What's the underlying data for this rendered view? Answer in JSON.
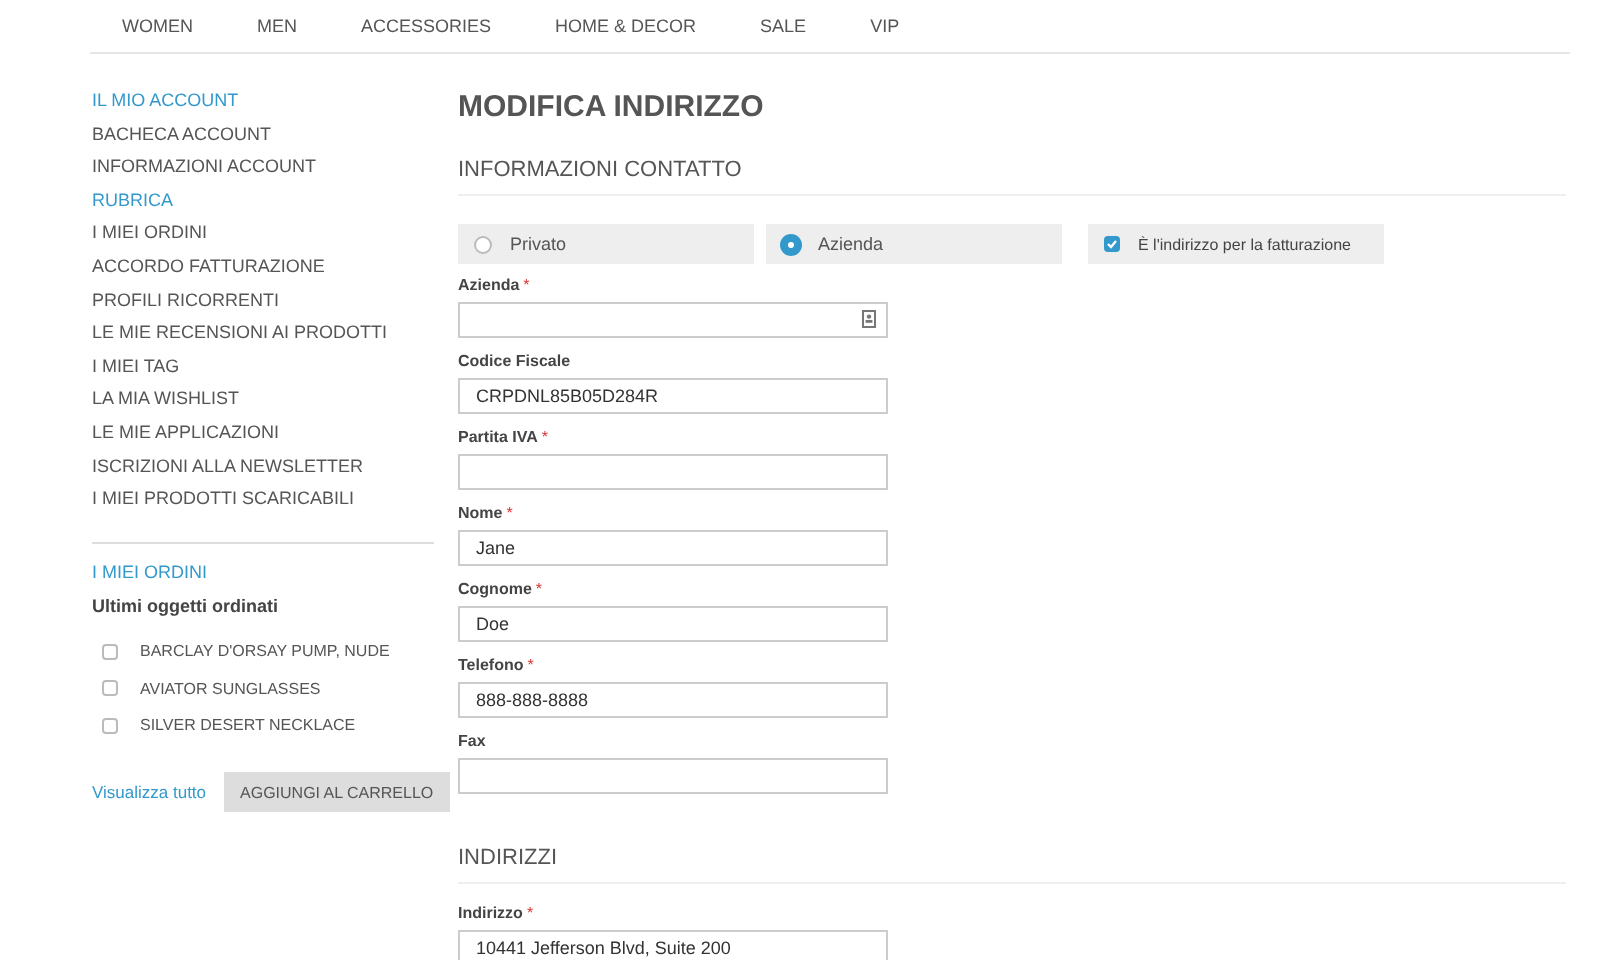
{
  "nav": [
    "WOMEN",
    "MEN",
    "ACCESSORIES",
    "HOME & DECOR",
    "SALE",
    "VIP"
  ],
  "sidebar": {
    "title": "IL MIO ACCOUNT",
    "items": [
      {
        "label": "BACHECA ACCOUNT",
        "selected": false
      },
      {
        "label": "INFORMAZIONI ACCOUNT",
        "selected": false
      },
      {
        "label": "RUBRICA",
        "selected": true
      },
      {
        "label": "I MIEI ORDINI",
        "selected": false
      },
      {
        "label": "ACCORDO FATTURAZIONE",
        "selected": false
      },
      {
        "label": "PROFILI RICORRENTI",
        "selected": false
      },
      {
        "label": "LE MIE RECENSIONI AI PRODOTTI",
        "selected": false
      },
      {
        "label": "I MIEI TAG",
        "selected": false
      },
      {
        "label": "LA MIA WISHLIST",
        "selected": false
      },
      {
        "label": "LE MIE APPLICAZIONI",
        "selected": false
      },
      {
        "label": "ISCRIZIONI ALLA NEWSLETTER",
        "selected": false
      },
      {
        "label": "I MIEI PRODOTTI SCARICABILI",
        "selected": false
      }
    ]
  },
  "orders": {
    "title": "I MIEI ORDINI",
    "subtitle": "Ultimi oggetti ordinati",
    "items": [
      {
        "label": "BARCLAY D'ORSAY PUMP, NUDE",
        "checked": false
      },
      {
        "label": "AVIATOR SUNGLASSES",
        "checked": false
      },
      {
        "label": "SILVER DESERT NECKLACE",
        "checked": false
      }
    ],
    "link": "Visualizza tutto",
    "button": "AGGIUNGI AL CARRELLO"
  },
  "page_title": "MODIFICA INDIRIZZO",
  "contact": {
    "heading": "INFORMAZIONI CONTATTO",
    "types": [
      {
        "label": "Privato",
        "selected": false
      },
      {
        "label": "Azienda",
        "selected": true
      }
    ],
    "billing": {
      "label": "È l'indirizzo per la fatturazione",
      "checked": true
    },
    "fields": [
      {
        "label": "Azienda",
        "required_mark": "*",
        "kind": "contact"
      },
      {
        "label": "Codice Fiscale",
        "value": "CRPDNL85B05D284R",
        "kind": "text"
      },
      {
        "label": "Partita IVA",
        "required_mark": "*",
        "kind": "text"
      },
      {
        "label": "Nome",
        "required_mark": "*",
        "value": "Jane",
        "kind": "text"
      },
      {
        "label": "Cognome",
        "required_mark": "*",
        "value": "Doe",
        "kind": "text"
      },
      {
        "label": "Telefono",
        "required_mark": "*",
        "value": "888-888-8888",
        "kind": "text"
      },
      {
        "label": "Fax",
        "kind": "text"
      }
    ]
  },
  "addresses": {
    "heading": "INDIRIZZI",
    "fields": [
      {
        "label": "Indirizzo",
        "required_mark": "*",
        "value": "10441 Jefferson Blvd, Suite 200",
        "kind": "text"
      }
    ]
  }
}
